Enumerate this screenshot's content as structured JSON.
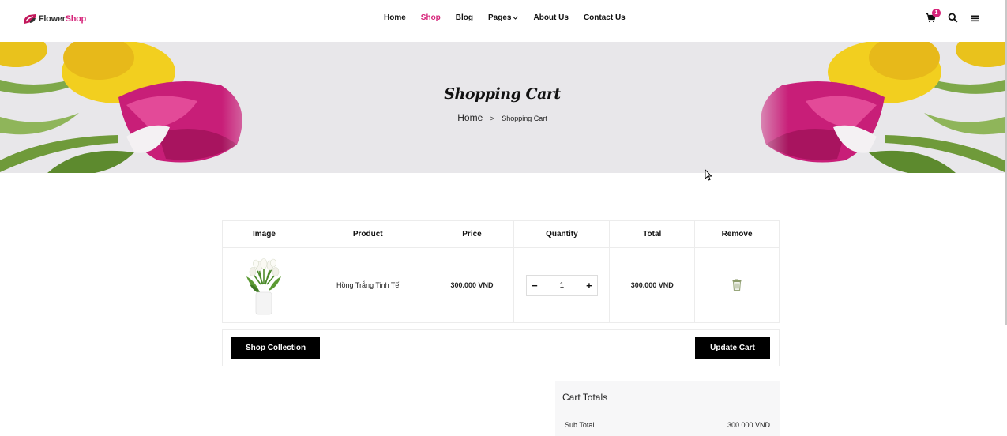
{
  "header": {
    "logo": {
      "part1": "Flower",
      "part2": "Shop"
    },
    "nav": [
      {
        "label": "Home"
      },
      {
        "label": "Shop"
      },
      {
        "label": "Blog"
      },
      {
        "label": "Pages"
      },
      {
        "label": "About Us"
      },
      {
        "label": "Contact Us"
      }
    ],
    "cart_count": "1",
    "icons": [
      "cart-icon",
      "search-icon",
      "menu-icon"
    ]
  },
  "banner": {
    "title": "Shopping Cart",
    "breadcrumb": {
      "home": "Home",
      "separator": ">",
      "current": "Shopping Cart"
    }
  },
  "cart": {
    "columns": [
      "Image",
      "Product",
      "Price",
      "Quantity",
      "Total",
      "Remove"
    ],
    "items": [
      {
        "product": "Hồng Trắng Tinh Tế",
        "price": "300.000 VND",
        "quantity": "1",
        "total": "300.000 VND"
      }
    ],
    "qty_minus": "−",
    "qty_plus": "+"
  },
  "actions": {
    "shop_label": "Shop Collection",
    "update_label": "Update Cart"
  },
  "totals": {
    "title": "Cart Totals",
    "subtotal_label": "Sub Total",
    "subtotal_value": "300.000 VND"
  },
  "colors": {
    "accent": "#d6247a",
    "banner_bg": "#e8e7ea",
    "button_bg": "#000000"
  }
}
